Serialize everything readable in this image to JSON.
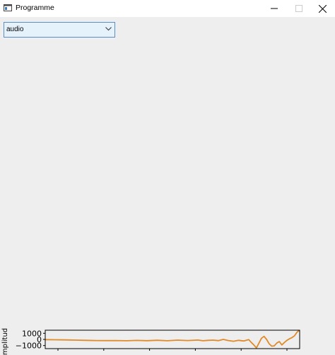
{
  "window": {
    "title": "Programme",
    "icon": "app-window-icon"
  },
  "controls": {
    "minimize": "minimize-icon",
    "maximize": "maximize-icon",
    "close": "close-icon"
  },
  "combo": {
    "value": "audio"
  },
  "chart_data": {
    "type": "line",
    "ylabel": "mplitud",
    "y_ticks": [
      "1000",
      "0",
      "−1000"
    ],
    "ylim": [
      -1500,
      1500
    ],
    "xlim": [
      0,
      100
    ],
    "line_color": "#e08a2a",
    "series": [
      {
        "x": [
          0,
          4,
          8,
          12,
          16,
          20,
          24,
          28,
          32,
          36,
          40,
          44,
          48,
          52,
          56,
          60,
          62,
          64,
          66,
          68,
          70,
          72,
          74,
          76,
          78,
          80,
          81,
          82,
          83,
          84,
          85,
          86,
          87,
          88,
          89,
          90,
          91,
          92,
          93,
          94,
          95,
          96,
          97,
          98,
          99,
          100
        ],
        "values": [
          -30,
          -60,
          -80,
          -120,
          -150,
          -180,
          -200,
          -180,
          -220,
          -160,
          -210,
          -140,
          -220,
          -120,
          -180,
          -100,
          -220,
          -150,
          -120,
          -200,
          0,
          -180,
          -300,
          -150,
          -250,
          -40,
          -500,
          -900,
          -1400,
          -600,
          200,
          500,
          0,
          -700,
          -1100,
          -1050,
          -600,
          -350,
          -900,
          -500,
          -150,
          100,
          300,
          600,
          1200,
          1600
        ]
      }
    ]
  }
}
